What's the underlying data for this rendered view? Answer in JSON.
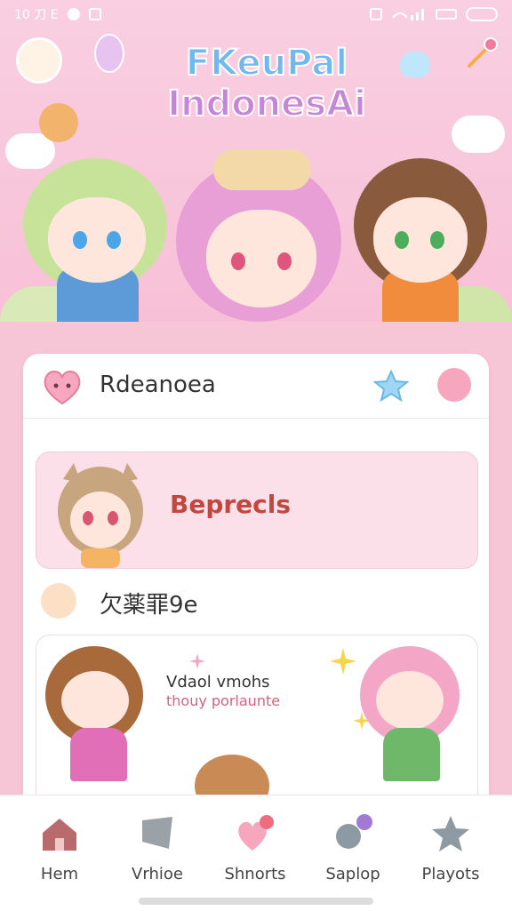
{
  "status_bar": {
    "time": "10 刀 E"
  },
  "header": {
    "title_line1": "FKeuPal",
    "title_line2": "IndonesAi"
  },
  "card": {
    "title": "Rdeanoea",
    "feature_label": "Beprecls",
    "section_label": "欠薬罪9e",
    "promo_line1": "Vdaol vmohs",
    "promo_line2": "thouy porlaunte"
  },
  "tabs": [
    {
      "label": "Hem",
      "icon": "home-icon"
    },
    {
      "label": "Vrhioe",
      "icon": "video-icon"
    },
    {
      "label": "Shnorts",
      "icon": "hearts-icon"
    },
    {
      "label": "Saplop",
      "icon": "explore-icon"
    },
    {
      "label": "Playots",
      "icon": "star-icon"
    }
  ],
  "colors": {
    "background": "#f6c6d6",
    "accent": "#f6a6bd",
    "feature_text": "#c2483f",
    "title_blue": "#6fb9f0",
    "title_purple": "#c685d8"
  }
}
